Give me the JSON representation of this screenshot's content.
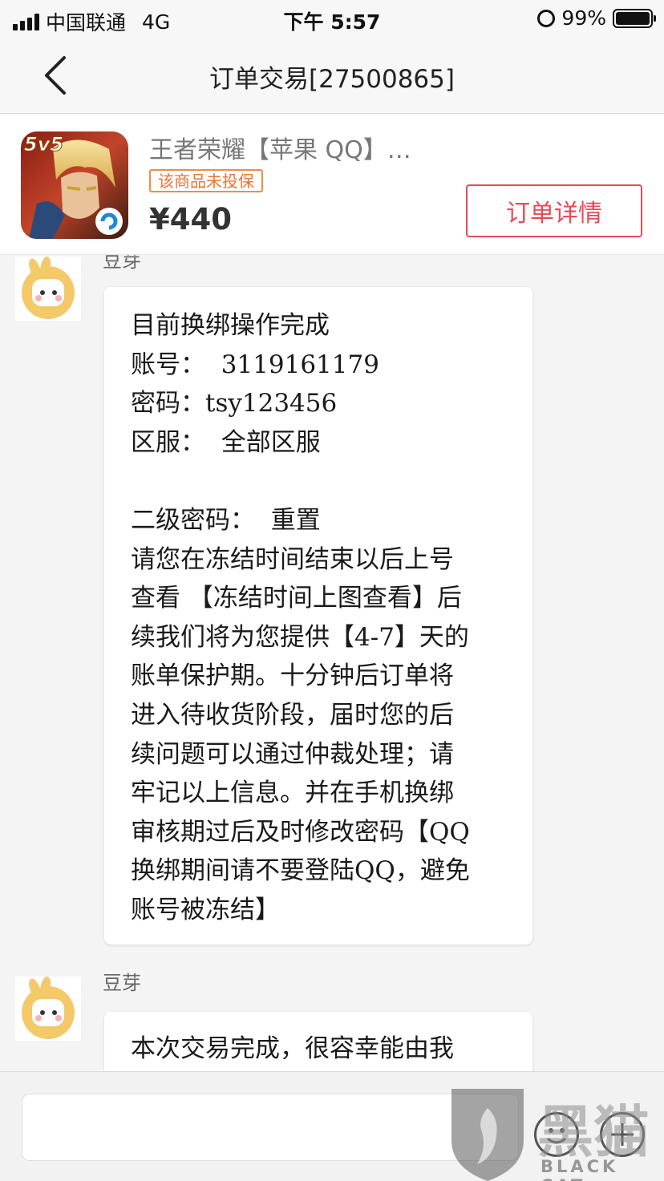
{
  "status_bar": {
    "carrier": "中国联通",
    "network": "4G",
    "time": "下午 5:57",
    "battery_percent": "99%",
    "battery_level": 0.99
  },
  "nav": {
    "title": "订单交易[27500865]",
    "back_icon": "chevron-left-icon"
  },
  "product": {
    "title": "王者荣耀【苹果 QQ】…",
    "badge": "该商品未投保",
    "price": "¥440",
    "detail_button": "订单详情",
    "game_logo_text": "5v5"
  },
  "chat": {
    "messages": [
      {
        "sender": "豆芽",
        "lines": [
          "目前换绑操作完成",
          "账号：  3119161179",
          "密码：tsy123456",
          "区服：  全部区服",
          "",
          "二级密码：  重置",
          "请您在冻结时间结束以后上号",
          "查看 【冻结时间上图查看】后",
          "续我们将为您提供【4-7】天的",
          "账单保护期。十分钟后订单将",
          "进入待收货阶段，届时您的后",
          "续问题可以通过仲裁处理；请",
          "牢记以上信息。并在手机换绑",
          "审核期过后及时修改密码【QQ",
          "换绑期间请不要登陆QQ，避免",
          "账号被冻结】"
        ]
      },
      {
        "sender": "豆芽",
        "lines": [
          "本次交易完成，很容幸能由我"
        ]
      }
    ]
  },
  "input_bar": {
    "emoji_icon": "emoji-icon",
    "plus_icon": "plus-icon"
  },
  "watermark": {
    "cn": "黑猫",
    "en": "BLACK CAT"
  },
  "colors": {
    "accent": "#e84a55",
    "badge": "#e8753a"
  }
}
